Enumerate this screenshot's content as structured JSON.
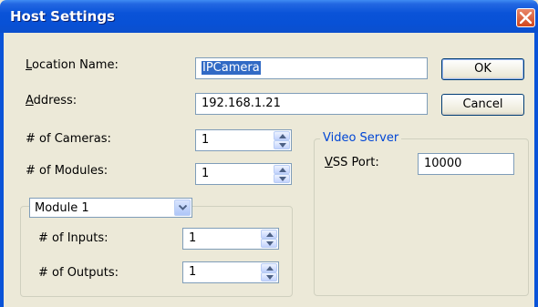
{
  "window": {
    "title": "Host Settings"
  },
  "location": {
    "label_mnemonic": "L",
    "label_rest": "ocation Name:",
    "value": "IPCamera"
  },
  "address": {
    "label_mnemonic": "A",
    "label_rest": "ddress:",
    "value": "192.168.1.21"
  },
  "buttons": {
    "ok": "OK",
    "cancel": "Cancel"
  },
  "cameras": {
    "label": "# of Cameras:",
    "value": "1"
  },
  "modules": {
    "label": "# of Modules:",
    "value": "1"
  },
  "module_group": {
    "selected_module": "Module 1",
    "inputs": {
      "label": "# of Inputs:",
      "value": "1"
    },
    "outputs": {
      "label": "# of Outputs:",
      "value": "1"
    }
  },
  "video_server": {
    "group_label": "Video Server",
    "vss_port": {
      "label_mnemonic": "V",
      "label_rest": "SS Port:",
      "value": "10000"
    }
  }
}
